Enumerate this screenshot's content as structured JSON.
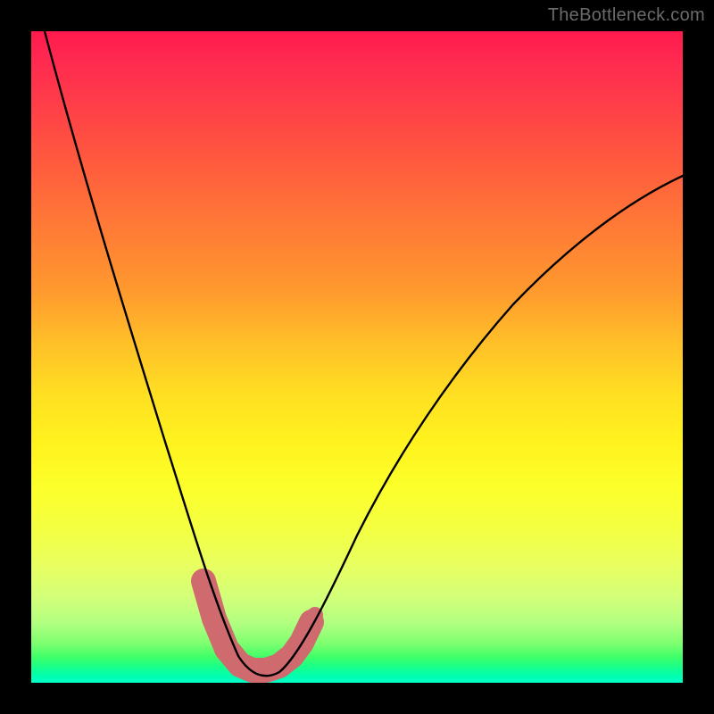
{
  "watermark": "TheBottleneck.com",
  "chart_data": {
    "type": "line",
    "title": "",
    "xlabel": "",
    "ylabel": "",
    "xlim": [
      0,
      100
    ],
    "ylim": [
      0,
      100
    ],
    "grid": false,
    "legend": false,
    "series": [
      {
        "name": "bottleneck-curve",
        "x": [
          2,
          6,
          10,
          14,
          18,
          22,
          26,
          29,
          31,
          33,
          35,
          37,
          40,
          44,
          50,
          56,
          62,
          70,
          78,
          86,
          94,
          100
        ],
        "y": [
          100,
          82,
          66,
          52,
          40,
          29,
          19,
          11,
          6,
          3,
          2,
          2,
          3,
          7,
          14,
          22,
          30,
          40,
          49,
          56,
          62,
          66
        ],
        "stroke": "#000000",
        "stroke_width": 2.2
      },
      {
        "name": "marker-band",
        "x": [
          26.5,
          28,
          30,
          32,
          34,
          36,
          38,
          40,
          41.5,
          43
        ],
        "y": [
          15,
          10,
          5,
          2.5,
          2,
          2,
          2.5,
          4,
          6,
          9
        ],
        "stroke": "#cf6a6f",
        "stroke_width": 13,
        "linecap": "round"
      }
    ],
    "annotations": []
  },
  "colors": {
    "background": "#000000",
    "gradient_top": "#ff1a4d",
    "gradient_bottom": "#00ffc8",
    "curve": "#000000",
    "marker_band": "#cf6a6f",
    "watermark": "#6b6b6b"
  }
}
